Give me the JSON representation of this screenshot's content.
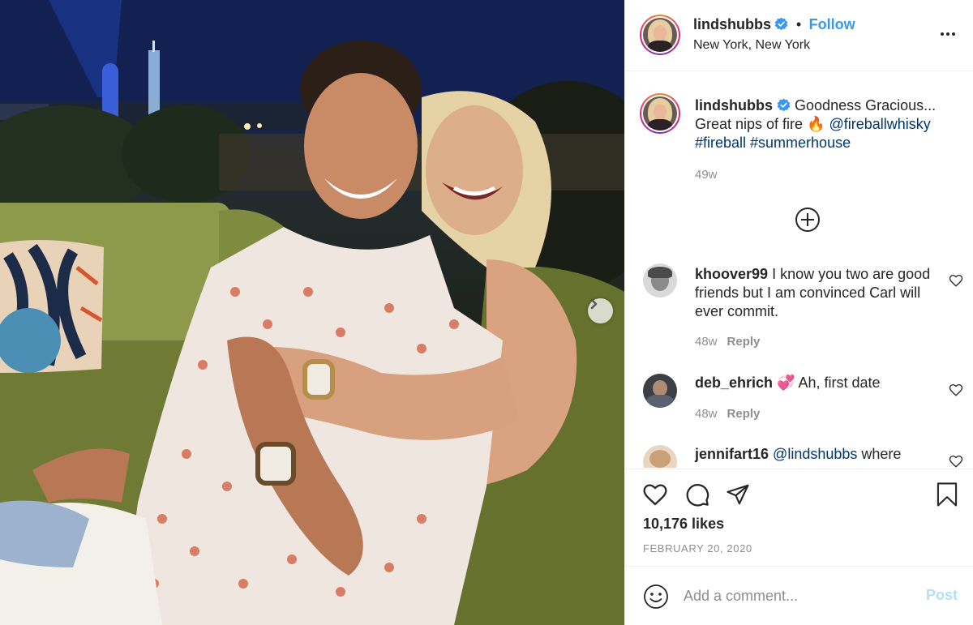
{
  "post": {
    "author": "lindshubbs",
    "follow_label": "Follow",
    "separator": "•",
    "location": "New York, New York",
    "caption": {
      "text_start": "Goodness Gracious... Great nips of fire 🔥 ",
      "mention": "@fireballwhisky",
      "hashtags": "#fireball #summerhouse",
      "age": "49w"
    },
    "load_more_icon": "plus-circle-icon",
    "likes": "10,176 likes",
    "date": "FEBRUARY 20, 2020"
  },
  "comments": [
    {
      "user": "khoover99",
      "text": "I know you two are good friends but I am convinced Carl will ever commit.",
      "age": "48w",
      "reply_label": "Reply"
    },
    {
      "user": "deb_ehrich",
      "emoji": "💞",
      "text": "Ah, first date",
      "age": "48w",
      "reply_label": "Reply"
    },
    {
      "user": "jennifart16",
      "mention": "@lindshubbs",
      "text": "where"
    }
  ],
  "composer": {
    "placeholder": "Add a comment...",
    "post_label": "Post",
    "emoji_icon": "smiley-icon"
  },
  "colors": {
    "link_blue": "#3897f0",
    "mention_blue": "#00376b",
    "muted": "#8e8e8e",
    "post_disabled": "#b2dffc",
    "verified_blue": "#3897f0"
  }
}
